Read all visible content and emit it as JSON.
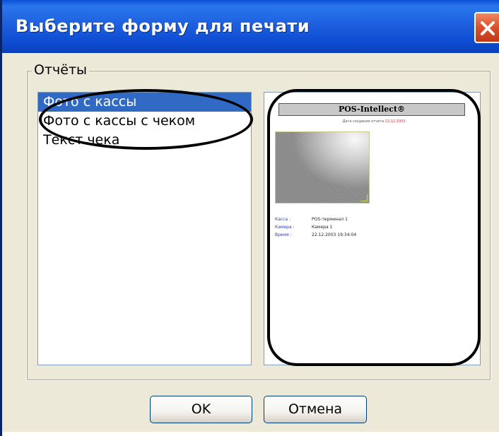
{
  "window": {
    "title": "Выберите форму для печати",
    "close_label": "×"
  },
  "reports": {
    "group_label": "Отчёты",
    "list_items": [
      {
        "label": "Фото с кассы",
        "selected": true
      },
      {
        "label": "Фото с кассы с чеком",
        "selected": false
      },
      {
        "label": "Текст чека",
        "selected": false
      }
    ]
  },
  "preview": {
    "header": "POS-Intellect®",
    "date_label": "Дата создания отчета",
    "date_value": "22.12.2003",
    "info": [
      {
        "label": "Касса :",
        "value": "POS-терминал 1"
      },
      {
        "label": "Камера :",
        "value": "Камера 1"
      },
      {
        "label": "Время :",
        "value": "22.12.2003 19:34:04"
      }
    ]
  },
  "buttons": {
    "ok": "OK",
    "cancel": "Отмена"
  },
  "colors": {
    "titlebar": "#0e4cd2",
    "selection": "#316ac5",
    "close": "#d9502a",
    "dialog_bg": "#ece9d8"
  }
}
